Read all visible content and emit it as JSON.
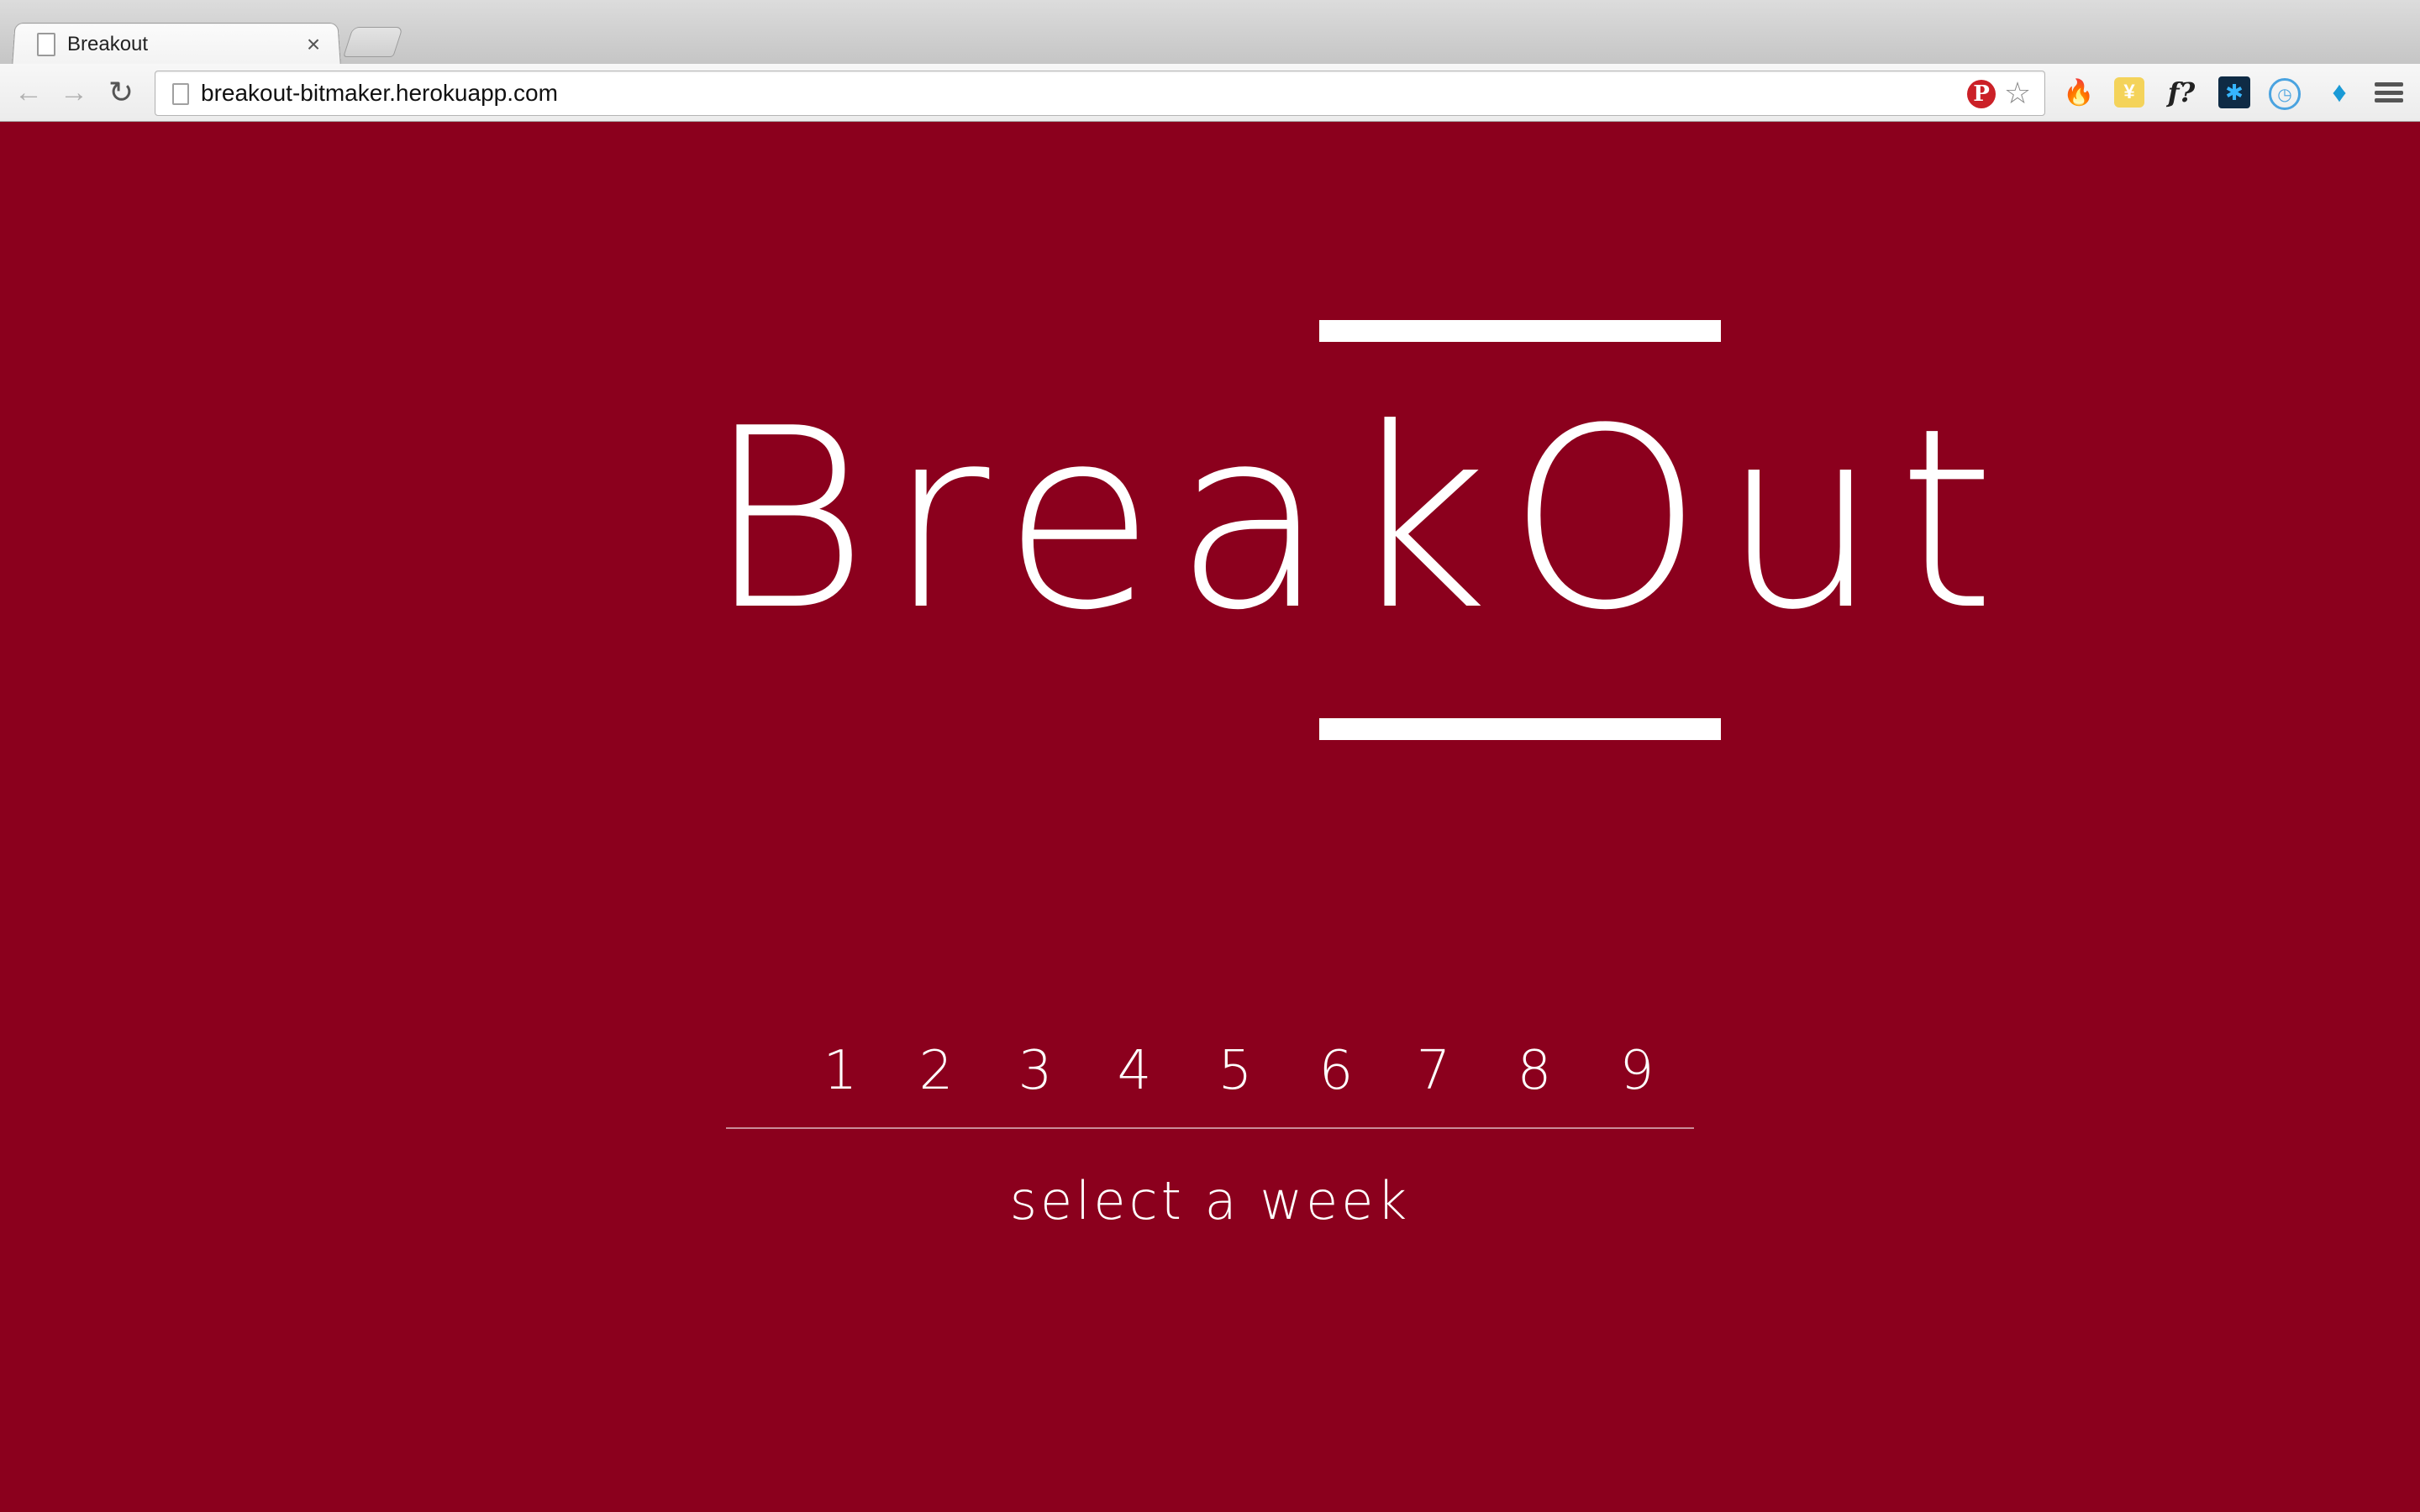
{
  "browser": {
    "tab": {
      "title": "Breakout",
      "close_glyph": "×",
      "icon": "page-icon"
    },
    "toolbar": {
      "back_glyph": "←",
      "forward_glyph": "→",
      "reload_glyph": "↻",
      "url": "breakout-bitmaker.herokuapp.com",
      "star_glyph": "☆",
      "pinterest_glyph": "P"
    },
    "extensions": [
      {
        "name": "flame-icon",
        "glyph": "🔥"
      },
      {
        "name": "yen-icon",
        "glyph": "¥"
      },
      {
        "name": "whatfont-icon",
        "glyph": "f?"
      },
      {
        "name": "bug-icon",
        "glyph": "✱"
      },
      {
        "name": "clock-icon",
        "glyph": "◷"
      },
      {
        "name": "diamond-icon",
        "glyph": "♦"
      }
    ]
  },
  "page": {
    "background_color": "#8b001d",
    "logo": {
      "title": "BreakOut"
    },
    "weeks": [
      "1",
      "2",
      "3",
      "4",
      "5",
      "6",
      "7",
      "8",
      "9"
    ],
    "prompt": "select a week"
  }
}
